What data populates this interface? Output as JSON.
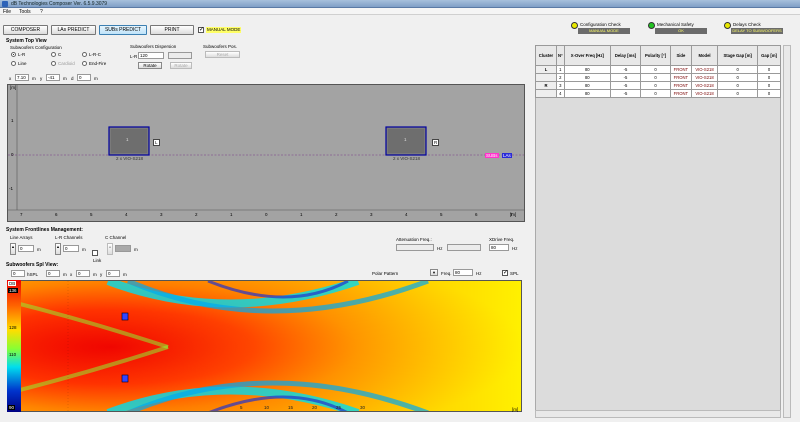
{
  "window": {
    "title": "dB Technologies Composer Ver. 6.5.9.3079"
  },
  "menu": {
    "items": [
      "File",
      "Tools",
      "?"
    ]
  },
  "toolbar": {
    "composer": "COMPOSER",
    "la_predict": "LAs PREDICT",
    "subs_predict": "SUBs PREDICT",
    "print": "PRINT",
    "manual_mode_label": "MANUAL MODE"
  },
  "status": {
    "configuration": {
      "label": "Configuration Check",
      "value": "MANUAL MODE",
      "color": "#e8e800"
    },
    "mechanical": {
      "label": "Mechanical Safety",
      "value": "OK",
      "color": "#22c322"
    },
    "delays": {
      "label": "Delays Check",
      "value": "DELAY TO SUBWOOFERS",
      "color": "#e8e800"
    }
  },
  "top_view": {
    "title": "System Top View",
    "sub_config_label": "Subwoofers Configuration",
    "options": [
      "L-R",
      "C",
      "L-R-C",
      "Line",
      "Cardioid",
      "End-Fire"
    ],
    "selected": "L-R",
    "dispersion_label": "Subwoofers Dispersion",
    "lr_label": "L-R",
    "lr_value": "120",
    "rotate": "Rotate",
    "rotate2": "Rotate",
    "pos_label": "Subwoofers Pos.",
    "reset": "Reset",
    "coords": {
      "x_label": "x",
      "x_val": "7.10",
      "x_unit": "m",
      "y_label": "y",
      "y_val": "-41",
      "y_unit": "m",
      "d_label": "d",
      "d_val": "0",
      "d_unit": "m"
    },
    "y_unit_label": "[m]",
    "y_ticks": [
      "1",
      "0",
      "-1"
    ],
    "x_ticks": [
      "7",
      "6",
      "5",
      "4",
      "3",
      "2",
      "1",
      "0",
      "1",
      "2",
      "3",
      "4",
      "5",
      "6",
      "7"
    ],
    "x_unit_label": "[m]",
    "left_sub": {
      "count": "1",
      "label": "2 x VIO-S218",
      "tag": "L"
    },
    "right_sub": {
      "count": "1",
      "label": "2 x VIO-S218",
      "tag": "R"
    },
    "legend_subs": "SUBs",
    "legend_las": "LAs"
  },
  "frontline": {
    "title": "System Frontlines Management:",
    "line_arrays": "Line Arrays",
    "lr_channels": "L-R Channels",
    "c_channel": "C Channel",
    "la_value": "0",
    "la_unit": "m",
    "lr_value": "0",
    "lr_unit": "m",
    "c_unit": "m",
    "link": "Link",
    "attenuation_label": "Attenuation Freq.:",
    "hz": "Hz",
    "xdrive_label": "XDrive Freq.",
    "xdrive_value": "80",
    "xdrive_unit": "Hz"
  },
  "spl_view": {
    "title": "Subwoofers Spl View:",
    "spl_height": "0",
    "spl_label": "hSPL",
    "x_val": "0",
    "x_label": "m",
    "y_label": "x",
    "y_val": "0",
    "m2": "m",
    "y_axis_label": "y",
    "z_val": "0",
    "m3": "m",
    "polar": "Polar Pattern",
    "freq_label": "Freq.",
    "freq_value": "80",
    "freq_unit": "Hz",
    "spl_check": "SPL",
    "db": "DB",
    "scale": [
      "136",
      "128",
      "110",
      "90"
    ],
    "x_ticks": [
      "5",
      "10",
      "15",
      "20",
      "25",
      "30"
    ],
    "x_unit": "[m]"
  },
  "table": {
    "headers": [
      "Cluster",
      "N°",
      "X-Over Freq [Hz]",
      "Delay [ms]",
      "Polarity [°]",
      "Side",
      "Model",
      "Stage Gap [m]",
      "Gap [m]"
    ],
    "rows": [
      {
        "cluster": "L",
        "n": "1",
        "xover": "80",
        "delay": "-5",
        "pol": "0",
        "side": "FRONT",
        "model": "VIO-S218",
        "stage": "0",
        "gap": "0"
      },
      {
        "cluster": "",
        "n": "2",
        "xover": "80",
        "delay": "-5",
        "pol": "0",
        "side": "FRONT",
        "model": "VIO-S218",
        "stage": "0",
        "gap": "0"
      },
      {
        "cluster": "R",
        "n": "3",
        "xover": "80",
        "delay": "-5",
        "pol": "0",
        "side": "FRONT",
        "model": "VIO-S218",
        "stage": "0",
        "gap": "0"
      },
      {
        "cluster": "",
        "n": "4",
        "xover": "80",
        "delay": "-5",
        "pol": "0",
        "side": "FRONT",
        "model": "VIO-S218",
        "stage": "0",
        "gap": "0"
      }
    ]
  },
  "colors": {
    "accent": "#3c7fb1",
    "subs_tag": "#ff33cc",
    "las_tag": "#2a2ad8"
  }
}
